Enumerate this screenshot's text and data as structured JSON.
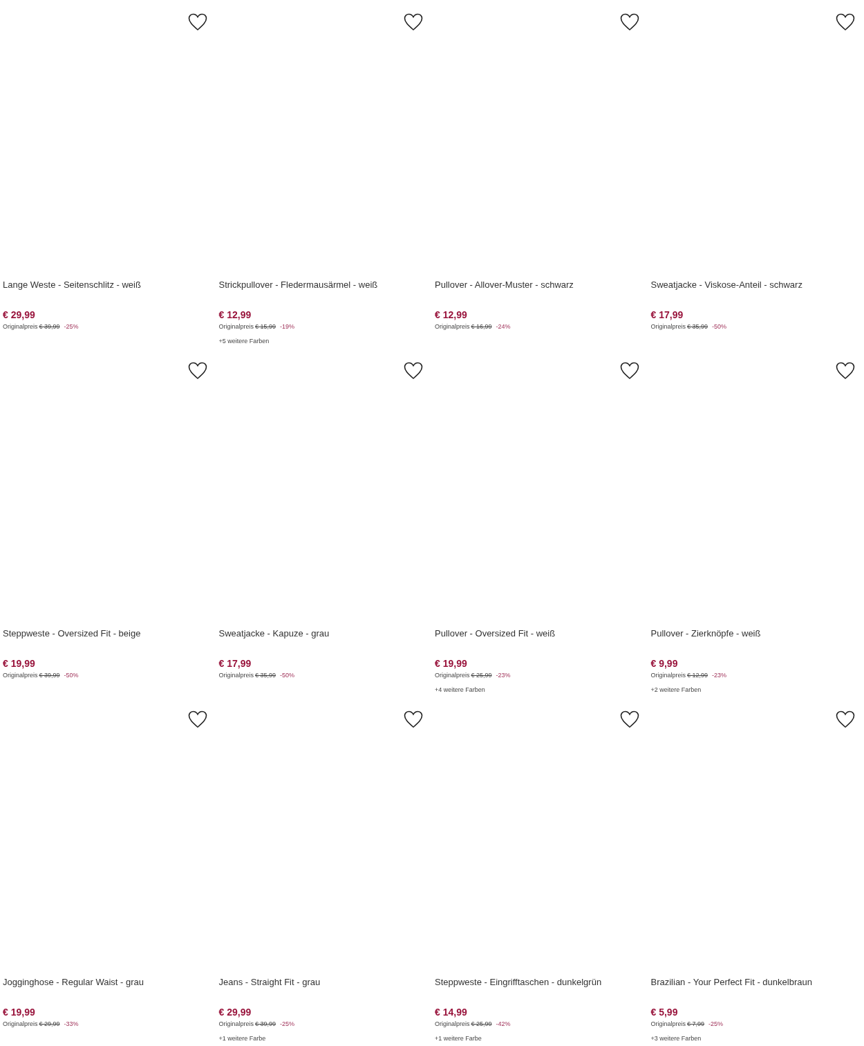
{
  "products": [
    {
      "title": "Lange Weste - Seitenschlitz - weiß",
      "price": "€ 29,99",
      "original_label": "Originalpreis",
      "original_price": "€ 39,99",
      "discount": "-25%"
    },
    {
      "title": "Strickpullover - Fledermausärmel - weiß",
      "price": "€ 12,99",
      "original_label": "Originalpreis",
      "original_price": "€ 15,99",
      "discount": "-19%",
      "more_colors": "+5 weitere Farben"
    },
    {
      "title": "Pullover - Allover-Muster - schwarz",
      "price": "€ 12,99",
      "original_label": "Originalpreis",
      "original_price": "€ 16,99",
      "discount": "-24%"
    },
    {
      "title": "Sweatjacke - Viskose-Anteil - schwarz",
      "price": "€ 17,99",
      "original_label": "Originalpreis",
      "original_price": "€ 35,99",
      "discount": "-50%"
    },
    {
      "title": "Steppweste - Oversized Fit - beige",
      "price": "€ 19,99",
      "original_label": "Originalpreis",
      "original_price": "€ 39,99",
      "discount": "-50%"
    },
    {
      "title": "Sweatjacke - Kapuze - grau",
      "price": "€ 17,99",
      "original_label": "Originalpreis",
      "original_price": "€ 35,99",
      "discount": "-50%"
    },
    {
      "title": "Pullover - Oversized Fit - weiß",
      "price": "€ 19,99",
      "original_label": "Originalpreis",
      "original_price": "€ 25,99",
      "discount": "-23%",
      "more_colors": "+4 weitere Farben"
    },
    {
      "title": "Pullover - Zierknöpfe - weiß",
      "price": "€ 9,99",
      "original_label": "Originalpreis",
      "original_price": "€ 12,99",
      "discount": "-23%",
      "more_colors": "+2 weitere Farben"
    },
    {
      "title": "Jogginghose - Regular Waist - grau",
      "price": "€ 19,99",
      "original_label": "Originalpreis",
      "original_price": "€ 29,99",
      "discount": "-33%"
    },
    {
      "title": "Jeans - Straight Fit - grau",
      "price": "€ 29,99",
      "original_label": "Originalpreis",
      "original_price": "€ 39,99",
      "discount": "-25%",
      "more_colors": "+1 weitere Farbe"
    },
    {
      "title": "Steppweste - Eingrifftaschen - dunkelgrün",
      "price": "€ 14,99",
      "original_label": "Originalpreis",
      "original_price": "€ 25,99",
      "discount": "-42%",
      "more_colors": "+1 weitere Farbe"
    },
    {
      "title": "Brazilian - Your Perfect Fit - dunkelbraun",
      "price": "€ 5,99",
      "original_label": "Originalpreis",
      "original_price": "€ 7,99",
      "discount": "-25%",
      "more_colors": "+3 weitere Farben"
    }
  ]
}
